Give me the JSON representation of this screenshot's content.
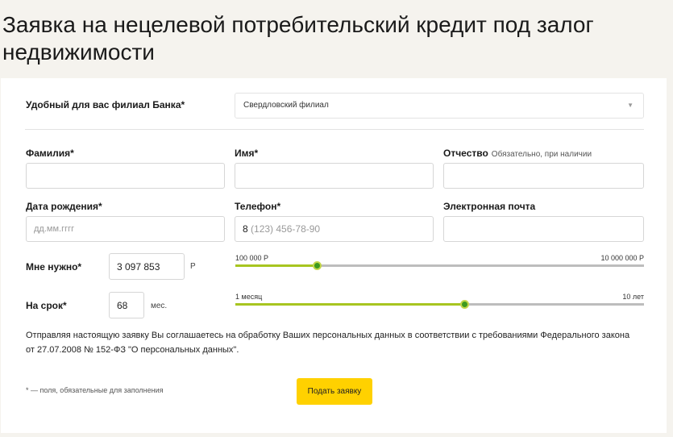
{
  "page": {
    "title": "Заявка на нецелевой потребительский кредит под залог недвижимости"
  },
  "branch": {
    "label": "Удобный для вас филиал Банка*",
    "value": "Свердловский филиал"
  },
  "fields": {
    "surname": {
      "label": "Фамилия*",
      "value": ""
    },
    "name": {
      "label": "Имя*",
      "value": ""
    },
    "patronymic": {
      "label": "Отчество",
      "hint": "Обязательно, при наличии",
      "value": ""
    },
    "birthdate": {
      "label": "Дата рождения*",
      "placeholder": "дд.мм.гггг"
    },
    "phone": {
      "label": "Телефон*",
      "prefix": "8",
      "placeholder": "(123) 456-78-90"
    },
    "email": {
      "label": "Электронная почта",
      "value": ""
    }
  },
  "amount": {
    "label": "Мне нужно*",
    "value": "3 097 853",
    "unit": "Р",
    "min_label": "100 000 Р",
    "max_label": "10 000 000 Р",
    "fraction": 0.2
  },
  "term": {
    "label": "На срок*",
    "value": "68",
    "unit": "мес.",
    "min_label": "1 месяц",
    "max_label": "10 лет",
    "fraction": 0.56
  },
  "consent_text": "Отправляя настоящую заявку Вы соглашаетесь на обработку Ваших персональных данных в соответствии с требованиями Федерального закона от 27.07.2008 № 152-ФЗ \"О персональных данных\".",
  "footnote": "* — поля, обязательные для заполнения",
  "submit_label": "Подать заявку",
  "colors": {
    "accent_button": "#ffd100",
    "slider_fill": "#a7c520",
    "slider_knob": "#3d9a1f"
  }
}
